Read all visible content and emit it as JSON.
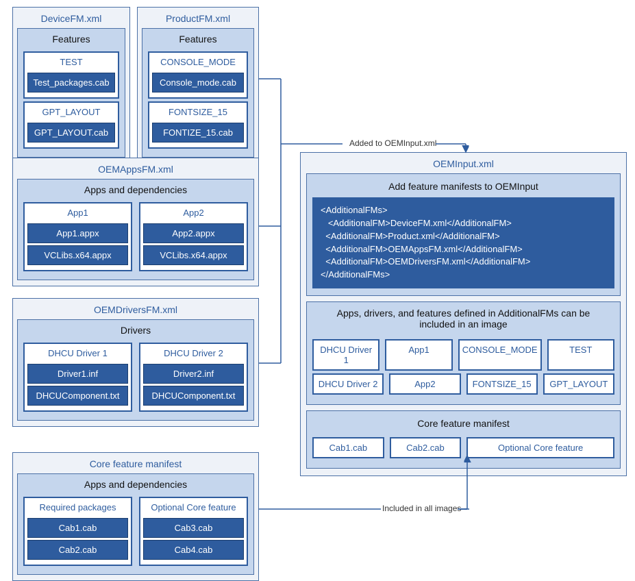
{
  "left": {
    "deviceFM": {
      "title": "DeviceFM.xml",
      "panelTitle": "Features",
      "features": [
        {
          "name": "TEST",
          "pkgs": [
            "Test_packages.cab"
          ]
        },
        {
          "name": "GPT_LAYOUT",
          "pkgs": [
            "GPT_LAYOUT.cab"
          ]
        }
      ]
    },
    "productFM": {
      "title": "ProductFM.xml",
      "panelTitle": "Features",
      "features": [
        {
          "name": "CONSOLE_MODE",
          "pkgs": [
            "Console_mode.cab"
          ]
        },
        {
          "name": "FONTSIZE_15",
          "pkgs": [
            "FONTIZE_15.cab"
          ]
        }
      ]
    },
    "oemApps": {
      "title": "OEMAppsFM.xml",
      "panelTitle": "Apps and dependencies",
      "apps": [
        {
          "name": "App1",
          "pkgs": [
            "App1.appx",
            "VCLibs.x64.appx"
          ]
        },
        {
          "name": "App2",
          "pkgs": [
            "App2.appx",
            "VCLibs.x64.appx"
          ]
        }
      ]
    },
    "oemDrivers": {
      "title": "OEMDriversFM.xml",
      "panelTitle": "Drivers",
      "drivers": [
        {
          "name": "DHCU Driver 1",
          "pkgs": [
            "Driver1.inf",
            "DHCUComponent.txt"
          ]
        },
        {
          "name": "DHCU Driver 2",
          "pkgs": [
            "Driver2.inf",
            "DHCUComponent.txt"
          ]
        }
      ]
    },
    "coreFM": {
      "title": "Core feature manifest",
      "panelTitle": "Apps and dependencies",
      "groups": [
        {
          "name": "Required packages",
          "pkgs": [
            "Cab1.cab",
            "Cab2.cab"
          ]
        },
        {
          "name": "Optional Core feature",
          "pkgs": [
            "Cab3.cab",
            "Cab4.cab"
          ]
        }
      ]
    }
  },
  "right": {
    "title": "OEMInput.xml",
    "addTitle": "Add feature manifests to OEMInput",
    "code": "<AdditionalFMs>\n   <AdditionalFM>DeviceFM.xml</AdditionalFM>\n  <AdditionalFM>Product.xml</AdditionalFM>\n  <AdditionalFM>OEMAppsFM.xml</AdditionalFM>\n  <AdditionalFM>OEMDriversFM.xml</AdditionalFM>\n</AdditionalFMs>",
    "includeTitle": "Apps, drivers, and features defined in AdditionalFMs can be included in an image",
    "chips": {
      "r1": [
        "DHCU Driver 1",
        "App1",
        "CONSOLE_MODE",
        "TEST"
      ],
      "r2": [
        "DHCU Driver 2",
        "App2",
        "FONTSIZE_15",
        "GPT_LAYOUT"
      ]
    },
    "coreTitle": "Core feature manifest",
    "coreChips": [
      "Cab1.cab",
      "Cab2.cab",
      "Optional Core feature"
    ]
  },
  "labels": {
    "addedTo": "Added to OEMInput.xml",
    "includedAll": "Included in all images"
  }
}
